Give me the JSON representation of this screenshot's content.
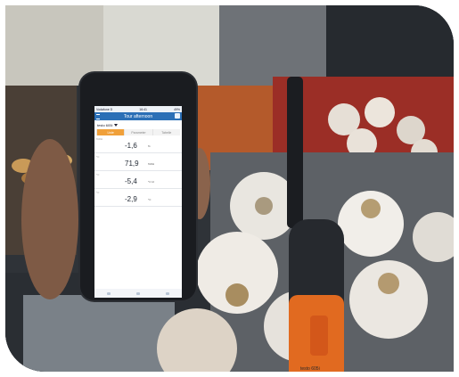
{
  "phone": {
    "status": {
      "carrier": "Vodafone D",
      "time": "16:41",
      "battery": "49%"
    },
    "title": "Tour afternoon",
    "device": "testo 605i",
    "tabs": [
      {
        "label": "Liste",
        "active": true
      },
      {
        "label": "Parameter"
      },
      {
        "label": "Tabelle"
      }
    ],
    "readings": [
      {
        "channel": "%RH",
        "value": "-1,6",
        "unit": "%"
      },
      {
        "channel": "°C",
        "value": "71,9",
        "unit": "%RH"
      },
      {
        "channel": "°C",
        "value": "-5,4",
        "unit": "°C td"
      },
      {
        "channel": "°C",
        "value": "-2,9",
        "unit": "°C"
      }
    ]
  },
  "probe": {
    "label": "testo 605i"
  },
  "colors": {
    "accent": "#2b6fb6",
    "tab_active": "#f0a03a",
    "probe": "#e16a20"
  }
}
